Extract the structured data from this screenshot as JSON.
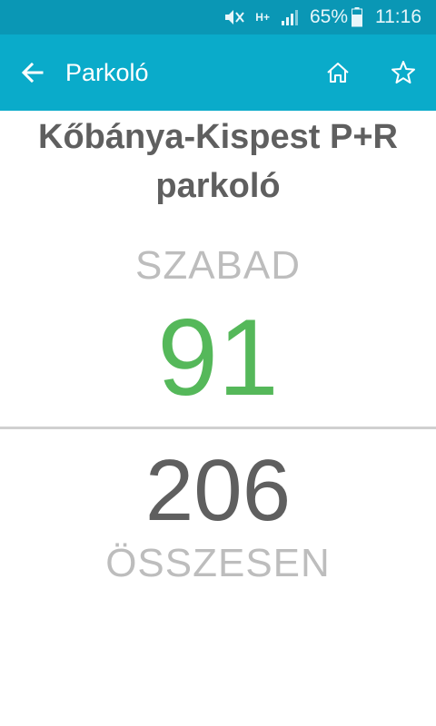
{
  "status_bar": {
    "network_type": "H+",
    "battery_percent": "65%",
    "time": "11:16"
  },
  "app_bar": {
    "title": "Parkoló",
    "back_icon": "arrow-left-icon",
    "home_icon": "home-icon",
    "favorite_icon": "star-outline-icon"
  },
  "parking": {
    "name": "Kőbánya-Kispest P+R parkoló",
    "free_label": "SZABAD",
    "free_count": "91",
    "total_count": "206",
    "total_label": "ÖSSZESEN"
  },
  "colors": {
    "status_bar": "#0a97b5",
    "app_bar": "#0aabca",
    "free_count": "#55b85a",
    "text_dark": "#5f5f5f",
    "text_light": "#bdbdbd"
  }
}
